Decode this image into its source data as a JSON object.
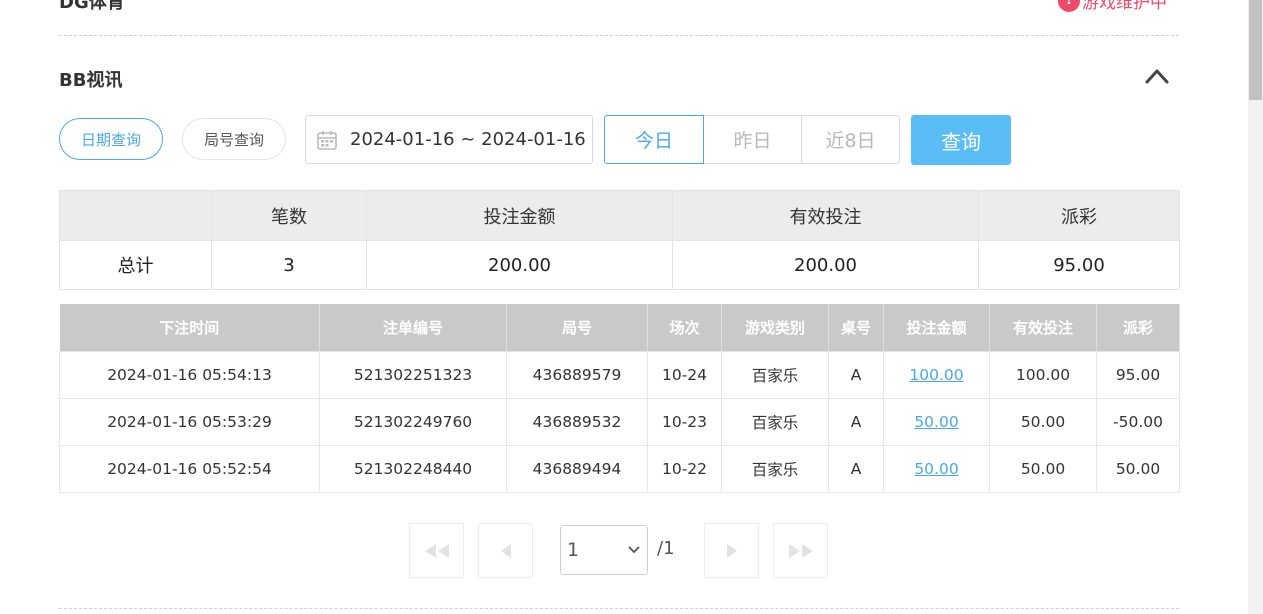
{
  "prev_section": {
    "title": "DG体育",
    "status": "游戏维护中"
  },
  "section": {
    "title": "BB视讯"
  },
  "tabs": {
    "date_query": "日期查询",
    "round_query": "局号查询"
  },
  "date_range": {
    "value": "2024-01-16 ~ 2024-01-16"
  },
  "quick": {
    "today": "今日",
    "yesterday": "昨日",
    "last8": "近8日"
  },
  "query_label": "查询",
  "summary": {
    "headers": [
      "",
      "笔数",
      "投注金额",
      "有效投注",
      "派彩"
    ],
    "row": [
      "总计",
      "3",
      "200.00",
      "200.00",
      "95.00"
    ]
  },
  "records": {
    "headers": [
      "下注时间",
      "注单编号",
      "局号",
      "场次",
      "游戏类别",
      "桌号",
      "投注金额",
      "有效投注",
      "派彩"
    ],
    "rows": [
      [
        "2024-01-16 05:54:13",
        "521302251323",
        "436889579",
        "10-24",
        "百家乐",
        "A",
        "100.00",
        "100.00",
        "95.00"
      ],
      [
        "2024-01-16 05:53:29",
        "521302249760",
        "436889532",
        "10-23",
        "百家乐",
        "A",
        "50.00",
        "50.00",
        "-50.00"
      ],
      [
        "2024-01-16 05:52:54",
        "521302248440",
        "436889494",
        "10-22",
        "百家乐",
        "A",
        "50.00",
        "50.00",
        "50.00"
      ]
    ]
  },
  "pager": {
    "current": "1",
    "total": "/1"
  },
  "colors": {
    "accent": "#4aa8e8",
    "primary_button": "#5bbdf5",
    "negative": "#e0445b",
    "warning": "#ef4a6c"
  }
}
